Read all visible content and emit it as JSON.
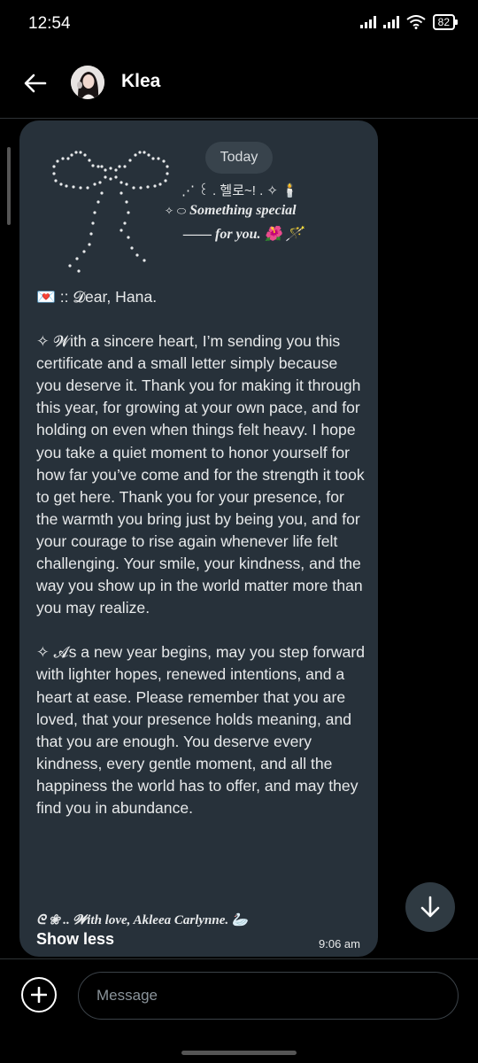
{
  "status_bar": {
    "time": "12:54",
    "battery": "82"
  },
  "header": {
    "contact_name": "Klea"
  },
  "chat": {
    "date_label": "Today",
    "message": {
      "deco_line1": "⋰ ꒰ . 헬로~! . ✧ 🕯️",
      "deco_line2_prefix": "✧ ⬭",
      "deco_line2": "Something special",
      "deco_line3": "—— for you. 🌺 🪄",
      "greeting": "💌 :: 𝓓ear, Hana.",
      "paragraph1": "✧  𝓦ith a sincere heart, I’m sending you this certificate and a small letter simply because you deserve it. Thank you for making it through this year, for growing at your own pace, and for holding on even when things felt heavy. I hope you take a quiet moment to honor yourself for how far you’ve come and for the strength it took to get here. Thank you for your presence, for the warmth you bring just by being you, and for your courage to rise again whenever life felt challenging. Your smile, your kindness, and the way you show up in the world matter more than you may realize.",
      "paragraph2": "✧  𝓐s a new year begins, may you step forward with lighter hopes, renewed intentions, and a heart at ease. Please remember that you are loved, that your presence holds meaning, and that you are enough. You deserve every kindness, every gentle moment, and all the happiness the world has to offer, and may they find you in abundance.",
      "signature": "ᘓ ❀ .. 𝓦ith love, Akleea Carlynne. 🦢",
      "show_less": "Show less",
      "time": "9:06 am"
    }
  },
  "composer": {
    "placeholder": "Message"
  },
  "colors": {
    "background": "#000000",
    "bubble": "#27313a",
    "pill": "#38434c"
  }
}
